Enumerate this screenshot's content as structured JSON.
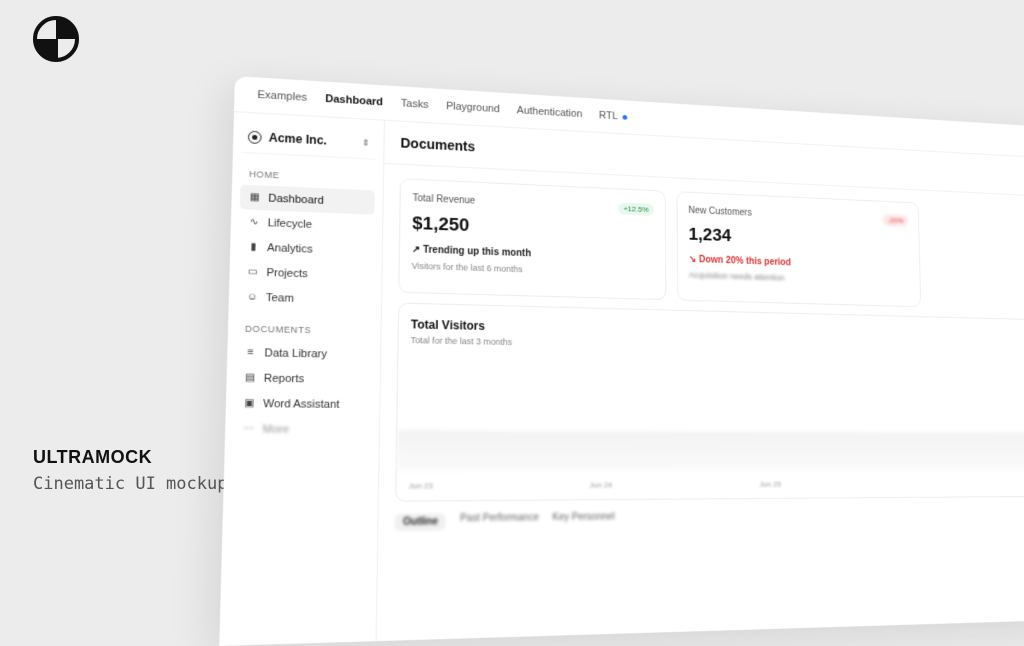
{
  "brand": {
    "name": "ULTRAMOCK",
    "tagline": "Cinematic UI mockup canvas"
  },
  "topnav": {
    "items": [
      "Examples",
      "Dashboard",
      "Tasks",
      "Playground",
      "Authentication",
      "RTL"
    ],
    "active": "Dashboard"
  },
  "sidebar": {
    "team": "Acme Inc.",
    "home_label": "HOME",
    "home_items": [
      {
        "label": "Dashboard",
        "icon": "grid-icon"
      },
      {
        "label": "Lifecycle",
        "icon": "pulse-icon"
      },
      {
        "label": "Analytics",
        "icon": "bar-chart-icon"
      },
      {
        "label": "Projects",
        "icon": "folder-icon"
      },
      {
        "label": "Team",
        "icon": "users-icon"
      }
    ],
    "documents_label": "DOCUMENTS",
    "document_items": [
      {
        "label": "Data Library",
        "icon": "database-icon"
      },
      {
        "label": "Reports",
        "icon": "report-icon"
      },
      {
        "label": "Word Assistant",
        "icon": "document-icon"
      },
      {
        "label": "More",
        "icon": "ellipsis-icon"
      }
    ]
  },
  "main": {
    "title": "Documents",
    "cards": [
      {
        "label": "Total Revenue",
        "value": "$1,250",
        "badge": "+12.5%",
        "trend": "Trending up this month",
        "sub": "Visitors for the last 6 months"
      },
      {
        "label": "New Customers",
        "value": "1,234",
        "badge": "-20%",
        "trend": "Down 20% this period",
        "sub": "Acquisition needs attention"
      }
    ],
    "visitors": {
      "title": "Total Visitors",
      "sub": "Total for the last 3 months",
      "axis": [
        "Jun 23",
        "Jun 24",
        "Jun 25"
      ]
    },
    "tabs": [
      "Outline",
      "Past Performance",
      "Key Personnel"
    ]
  },
  "colors": {
    "accent_blue": "#2f6fed",
    "positive": "#1a8f3a",
    "negative": "#d33333"
  }
}
